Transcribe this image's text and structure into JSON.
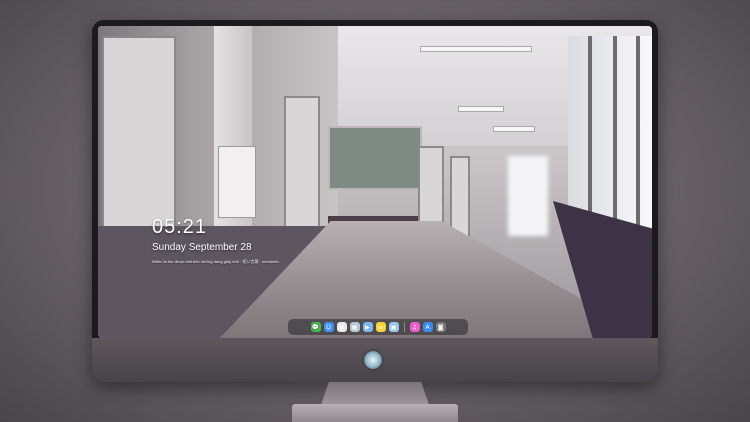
{
  "lock_screen": {
    "time": "05:21",
    "date": "Sunday September  28",
    "note": "Nhiều lá thư được viết trên những trang giấy nhỏ · 短い言葉 · memento"
  },
  "dock": {
    "items": [
      {
        "name": "messages-icon",
        "color": "#3fbf4a",
        "glyph": "💬"
      },
      {
        "name": "finder-icon",
        "color": "#3d8ef0",
        "glyph": "☺"
      },
      {
        "name": "chrome-icon",
        "color": "#e8e8e8",
        "glyph": "◉"
      },
      {
        "name": "preview-icon",
        "color": "#b7c7d6",
        "glyph": "▦"
      },
      {
        "name": "video-icon",
        "color": "#7fb6ee",
        "glyph": "▶"
      },
      {
        "name": "notes-icon",
        "color": "#f5d33b",
        "glyph": "≡"
      },
      {
        "name": "photos-icon",
        "color": "#9acbe2",
        "glyph": "▣"
      },
      {
        "name": "itunes-icon",
        "color": "#e85fc9",
        "glyph": "♫"
      },
      {
        "name": "appstore-icon",
        "color": "#3c8cf0",
        "glyph": "A"
      },
      {
        "name": "camera-icon",
        "color": "#7a7a7a",
        "glyph": "◙"
      }
    ]
  }
}
